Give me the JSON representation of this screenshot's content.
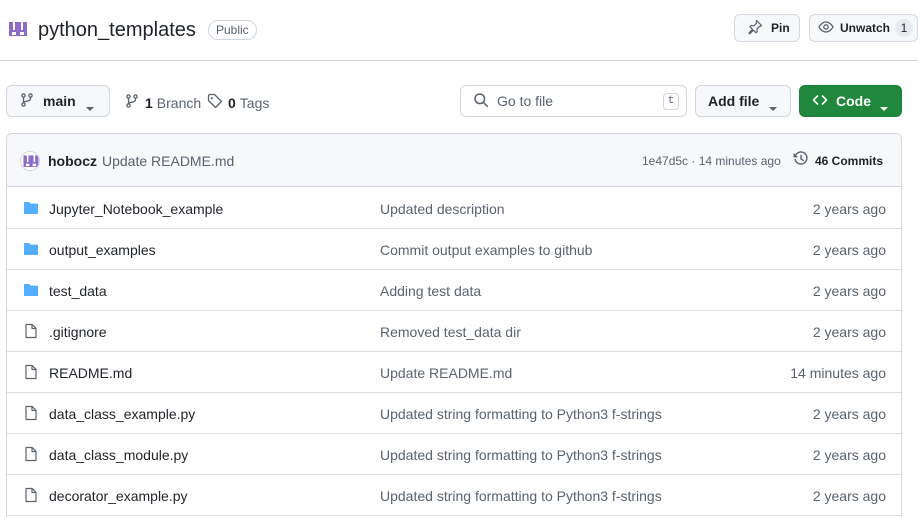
{
  "repo": {
    "name": "python_templates",
    "visibility": "Public",
    "pin_label": "Pin",
    "unwatch_label": "Unwatch",
    "watch_count": "1"
  },
  "toolbar": {
    "branch": "main",
    "branches_count": "1",
    "branches_label": "Branch",
    "tags_count": "0",
    "tags_label": "Tags",
    "search_placeholder": "Go to file",
    "search_shortcut": "t",
    "add_file_label": "Add file",
    "code_label": "Code"
  },
  "commit": {
    "author": "hobocz",
    "message": "Update README.md",
    "meta": "1e47d5c · 14 minutes ago",
    "count_label": "46 Commits"
  },
  "files": [
    {
      "icon": "folder-icon",
      "name": "Jupyter_Notebook_example",
      "message": "Updated description",
      "age": "2 years ago"
    },
    {
      "icon": "folder-icon",
      "name": "output_examples",
      "message": "Commit output examples to github",
      "age": "2 years ago"
    },
    {
      "icon": "folder-icon",
      "name": "test_data",
      "message": "Adding test data",
      "age": "2 years ago"
    },
    {
      "icon": "file-icon",
      "name": ".gitignore",
      "message": "Removed test_data dir",
      "age": "2 years ago"
    },
    {
      "icon": "file-icon",
      "name": "README.md",
      "message": "Update README.md",
      "age": "14 minutes ago"
    },
    {
      "icon": "file-icon",
      "name": "data_class_example.py",
      "message": "Updated string formatting to Python3 f-strings",
      "age": "2 years ago"
    },
    {
      "icon": "file-icon",
      "name": "data_class_module.py",
      "message": "Updated string formatting to Python3 f-strings",
      "age": "2 years ago"
    },
    {
      "icon": "file-icon",
      "name": "decorator_example.py",
      "message": "Updated string formatting to Python3 f-strings",
      "age": "2 years ago"
    }
  ],
  "colors": {
    "accent_green": "#1f883d",
    "folder_blue": "#54aeff",
    "avatar_purple": "#8d6cc9"
  }
}
